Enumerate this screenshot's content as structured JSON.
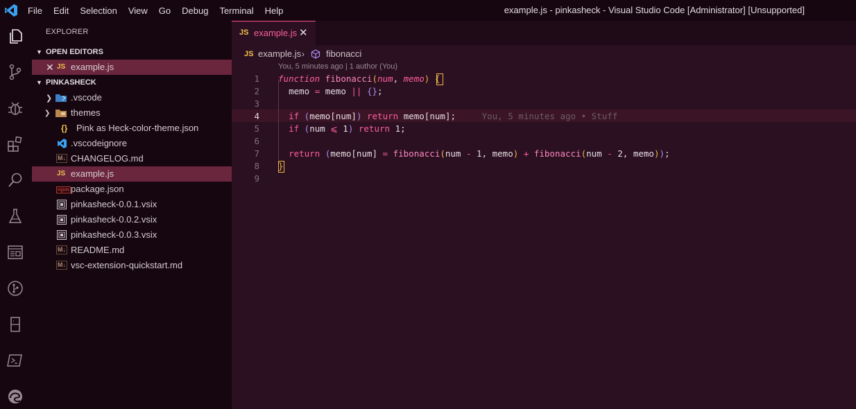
{
  "window": {
    "title": "example.js - pinkasheck - Visual Studio Code [Administrator] [Unsupported]"
  },
  "menu": [
    "File",
    "Edit",
    "Selection",
    "View",
    "Go",
    "Debug",
    "Terminal",
    "Help"
  ],
  "activity_bar": [
    "files-icon",
    "source-control-icon",
    "debug-icon",
    "extensions-icon",
    "search-icon",
    "test-flask-icon",
    "browser-window-icon",
    "git-graph-icon",
    "bookmark-icon",
    "terminal-icon",
    "edge-icon"
  ],
  "sidebar": {
    "title": "EXPLORER",
    "open_editors": {
      "label": "OPEN EDITORS",
      "items": [
        {
          "badge": "JS",
          "name": "example.js"
        }
      ]
    },
    "project": {
      "label": "PINKASHECK",
      "items": [
        {
          "name": ".vscode",
          "icon": "folder-vscode-icon"
        },
        {
          "name": "themes",
          "icon": "folder-themes-icon"
        },
        {
          "name": "Pink as Heck-color-theme.json",
          "icon": "json-icon"
        },
        {
          "name": ".vscodeignore",
          "icon": "vscode-icon"
        },
        {
          "name": "CHANGELOG.md",
          "icon": "markdown-icon"
        },
        {
          "name": "example.js",
          "icon": "js-icon"
        },
        {
          "name": "package.json",
          "icon": "npm-icon"
        },
        {
          "name": "pinkasheck-0.0.1.vsix",
          "icon": "vsix-icon"
        },
        {
          "name": "pinkasheck-0.0.2.vsix",
          "icon": "vsix-icon"
        },
        {
          "name": "pinkasheck-0.0.3.vsix",
          "icon": "vsix-icon"
        },
        {
          "name": "README.md",
          "icon": "markdown-icon"
        },
        {
          "name": "vsc-extension-quickstart.md",
          "icon": "markdown-icon"
        }
      ]
    }
  },
  "editor": {
    "tab": {
      "badge": "JS",
      "name": "example.js"
    },
    "breadcrumb": {
      "file": "example.js",
      "symbol": "fibonacci"
    },
    "codelens": "You, 5 minutes ago | 1 author (You)",
    "blame": "You, 5 minutes ago • Stuff",
    "line_numbers": [
      "1",
      "2",
      "3",
      "4",
      "5",
      "6",
      "7",
      "8",
      "9"
    ],
    "current_line": 4,
    "code": {
      "l1": {
        "k": "function",
        "f": "fibonacci",
        "p1": "(",
        "a1": "num",
        "c": ", ",
        "a2": "memo",
        "p2": ")",
        "b": "{"
      },
      "l2": {
        "a": "memo",
        "op": " = ",
        "b": "memo",
        "or": " || ",
        "o": "{}",
        "end": ";"
      },
      "l4": {
        "if": "if",
        "p1": " (",
        "m": "memo",
        "br1": "[",
        "n": "num",
        "br2": "]",
        "p2": ")",
        "ret": " return ",
        "m2": "memo",
        "br3": "[",
        "n2": "num",
        "br4": "]",
        "end": ";"
      },
      "l5": {
        "if": "if",
        "p1": " (",
        "n": "num",
        "le": " ⩽ ",
        "one": "1",
        "p2": ")",
        "ret": " return ",
        "one2": "1",
        "end": ";"
      },
      "l7": {
        "ret": "return",
        "p1": " (",
        "m": "memo",
        "br1": "[",
        "n": "num",
        "br2": "]",
        "eq": " = ",
        "f1": "fibonacci",
        "q1": "(",
        "n1": "num",
        "minus1": " - ",
        "one": "1",
        "c1": ", ",
        "m1": "memo",
        "q2": ")",
        "plus": " + ",
        "f2": "fibonacci",
        "q3": "(",
        "n2": "num",
        "minus2": " - ",
        "two": "2",
        "c2": ", ",
        "m2": "memo",
        "q4": ")",
        "p2": ")",
        "end": ";"
      },
      "l8": {
        "b": "}"
      }
    }
  },
  "colors": {
    "accent": "#ff5f9e",
    "background": "#2a1020",
    "sidebar": "#15060f",
    "selection": "#6a263d"
  }
}
